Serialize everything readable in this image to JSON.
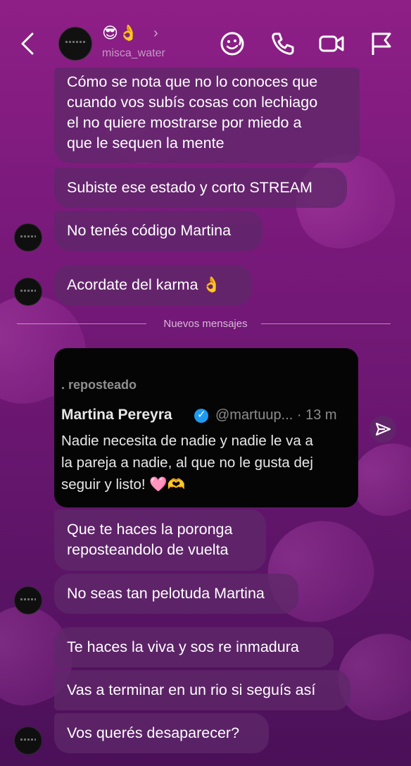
{
  "header": {
    "contact_emoji": "😎👌",
    "chevron": "›",
    "username": "misca_water"
  },
  "messages": [
    {
      "text": "Cómo se nota que no lo conoces que\ncuando vos subís cosas con lechiago\nel no quiere mostrarse por miedo a\nque le sequen la mente"
    },
    {
      "text": "Subiste ese estado y corto STREAM"
    },
    {
      "text": "No tenés código Martina"
    },
    {
      "text": "Acordate del karma 👌"
    },
    {
      "text": "Que te haces la poronga\nreposteandolo de vuelta"
    },
    {
      "text": "No seas tan pelotuda Martina"
    },
    {
      "text": "Te haces la viva y sos re inmadura"
    },
    {
      "text": "Vas a terminar en un rio si seguís así"
    },
    {
      "text": "Vos querés desaparecer?"
    }
  ],
  "divider": {
    "label": "Nuevos mensajes"
  },
  "shared_post": {
    "repost_label": ". reposteado",
    "author": "Martina Pereyra",
    "handle": "@martuup... · 13 m",
    "text": "Nadie necesita de nadie y nadie le va a\nla pareja a nadie, al que no le gusta dej\nseguir y listo! 🩷🫶"
  },
  "icons": {
    "back": "back-chevron-icon",
    "sticker": "sticker-face-icon",
    "call": "phone-icon",
    "video": "video-camera-icon",
    "report": "flag-icon",
    "share": "send-paper-plane-icon"
  }
}
